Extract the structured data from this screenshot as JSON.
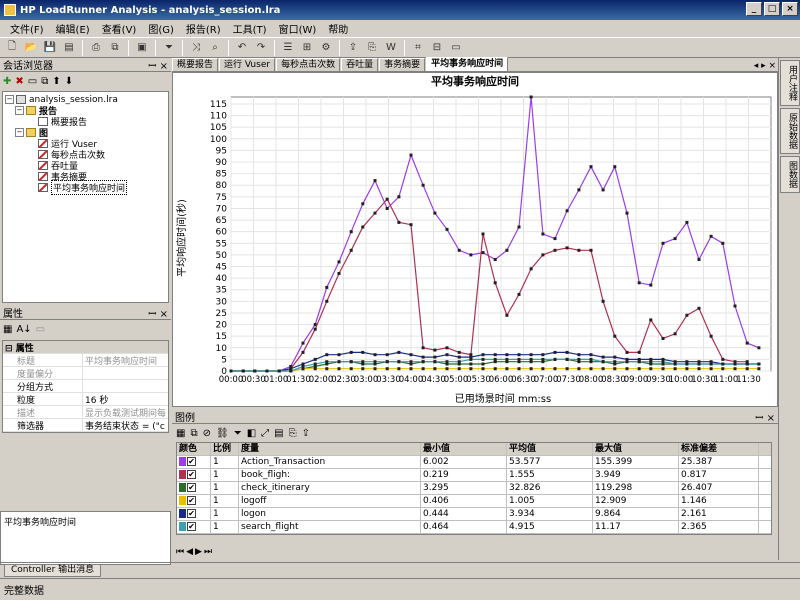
{
  "window": {
    "title": "HP LoadRunner Analysis - analysis_session.lra",
    "buttons": [
      "_",
      "□",
      "×"
    ]
  },
  "menu": [
    "文件(F)",
    "编辑(E)",
    "查看(V)",
    "图(G)",
    "报告(R)",
    "工具(T)",
    "窗口(W)",
    "帮助"
  ],
  "session_browser": {
    "title": "会话浏览器",
    "root": "analysis_session.lra",
    "report_folder": "报告",
    "report_items": [
      "概要报告"
    ],
    "graph_folder": "图",
    "graph_items": [
      "运行 Vuser",
      "每秒点击次数",
      "吞吐量",
      "事务摘要",
      "平均事务响应时间"
    ]
  },
  "properties": {
    "title": "属性",
    "section": "属性",
    "rows": [
      {
        "k": "标题",
        "v": "平均事务响应时间",
        "dim": true
      },
      {
        "k": "度量偏分",
        "v": "",
        "dim": true
      },
      {
        "k": "分组方式",
        "v": "",
        "dim": false
      },
      {
        "k": "粒度",
        "v": "16 秒",
        "dim": false
      },
      {
        "k": "描述",
        "v": "显示负载测试期间每",
        "dim": true
      },
      {
        "k": "筛选器",
        "v": "事务结束状态 = (\"c",
        "dim": false
      }
    ],
    "description": "平均事务响应时间"
  },
  "tabs": [
    "概要报告",
    "运行 Vuser",
    "每秒点击次数",
    "吞吐量",
    "事务摘要",
    "平均事务响应时间"
  ],
  "tab_nav": "◂ ▸ ×",
  "chart_data": {
    "type": "line",
    "title": "平均事务响应时间",
    "xlabel": "已用场景时间 mm:ss",
    "ylabel": "平均响应时间(秒)",
    "ylim": [
      0,
      118
    ],
    "yticks": [
      0,
      5,
      10,
      15,
      20,
      25,
      30,
      35,
      40,
      45,
      50,
      55,
      60,
      65,
      70,
      75,
      80,
      85,
      90,
      95,
      100,
      105,
      110,
      115
    ],
    "x": [
      "00:00",
      "00:30",
      "01:00",
      "01:30",
      "02:00",
      "02:30",
      "03:00",
      "03:30",
      "04:00",
      "04:30",
      "05:00",
      "05:30",
      "06:00",
      "06:30",
      "07:00",
      "07:30",
      "08:00",
      "08:30",
      "09:00",
      "09:30",
      "10:00",
      "10:30",
      "11:00",
      "11:30"
    ],
    "xmax_minutes": 12,
    "x_minutes": [
      0,
      0.27,
      0.53,
      0.8,
      1.07,
      1.33,
      1.6,
      1.87,
      2.13,
      2.4,
      2.67,
      2.93,
      3.2,
      3.47,
      3.73,
      4.0,
      4.27,
      4.53,
      4.8,
      5.07,
      5.33,
      5.6,
      5.87,
      6.13,
      6.4,
      6.67,
      6.93,
      7.2,
      7.47,
      7.73,
      8.0,
      8.27,
      8.53,
      8.8,
      9.07,
      9.33,
      9.6,
      9.87,
      10.13,
      10.4,
      10.67,
      10.93,
      11.2,
      11.47,
      11.73
    ],
    "series": [
      {
        "name": "Action_Transaction",
        "color": "#9b3cf0",
        "values": [
          0,
          0,
          0,
          0,
          0,
          2,
          12,
          20,
          36,
          47,
          60,
          72,
          82,
          70,
          75,
          93,
          80,
          68,
          61,
          52,
          50,
          51,
          48,
          52,
          62,
          118,
          59,
          57,
          69,
          78,
          88,
          78,
          88,
          68,
          38,
          37,
          55,
          57,
          64,
          48,
          58,
          55,
          28,
          12,
          10,
          6
        ]
      },
      {
        "name": "book_flight",
        "color": "#b03050",
        "values": [
          0,
          0,
          0,
          0,
          0,
          1,
          8,
          18,
          30,
          42,
          52,
          62,
          68,
          74,
          64,
          63,
          10,
          9,
          10,
          8,
          7,
          59,
          38,
          24,
          33,
          44,
          50,
          52,
          53,
          52,
          52,
          30,
          15,
          8,
          8,
          22,
          14,
          16,
          24,
          27,
          15,
          5,
          4,
          4
        ]
      },
      {
        "name": "check_itinerary",
        "color": "#2a6e2a",
        "values": [
          0,
          0,
          0,
          0,
          0,
          0,
          1,
          2,
          3,
          4,
          4,
          3,
          3,
          4,
          4,
          3,
          4,
          4,
          3,
          3,
          3,
          3,
          4,
          4,
          4,
          4,
          4,
          5,
          5,
          4,
          4,
          4,
          3,
          4,
          4,
          3,
          3,
          3,
          3,
          3,
          3,
          3,
          3,
          3,
          3
        ]
      },
      {
        "name": "logoff",
        "color": "#e8c000",
        "values": [
          0,
          0,
          0,
          0,
          0,
          0,
          1,
          1,
          1,
          1,
          1,
          1,
          1,
          1,
          1,
          1,
          1,
          1,
          1,
          1,
          1,
          1,
          1,
          1,
          1,
          1,
          1,
          1,
          1,
          1,
          1,
          1,
          1,
          1,
          1,
          1,
          1,
          1,
          1,
          1,
          1,
          1,
          1,
          1,
          1
        ]
      },
      {
        "name": "logon",
        "color": "#1a2a8a",
        "values": [
          0,
          0,
          0,
          0,
          0,
          1,
          3,
          5,
          7,
          7,
          8,
          8,
          7,
          7,
          8,
          7,
          6,
          6,
          7,
          6,
          6,
          7,
          7,
          7,
          7,
          7,
          7,
          8,
          8,
          7,
          7,
          6,
          6,
          5,
          5,
          5,
          5,
          4,
          4,
          4,
          4,
          3,
          3,
          3,
          3
        ]
      },
      {
        "name": "search_flight",
        "color": "#3aa0b0",
        "values": [
          0,
          0,
          0,
          0,
          0,
          0,
          2,
          3,
          4,
          4,
          4,
          4,
          4,
          4,
          4,
          4,
          4,
          4,
          4,
          4,
          5,
          5,
          5,
          5,
          5,
          5,
          5,
          5,
          5,
          5,
          5,
          4,
          4,
          4,
          4,
          4,
          4,
          3,
          3,
          3,
          3,
          3,
          3,
          3,
          3
        ]
      }
    ]
  },
  "legend": {
    "title": "图例",
    "headers": [
      "颜色",
      "比例",
      "度量",
      "最小值",
      "平均值",
      "最大值",
      "标准偏差"
    ],
    "rows": [
      {
        "color": "#9b3cf0",
        "scale": "1",
        "measure": "Action_Transaction",
        "min": "6.002",
        "avg": "53.577",
        "max": "155.399",
        "std": "25.387"
      },
      {
        "color": "#b03050",
        "scale": "1",
        "measure": "book_fligh:",
        "min": "0.219",
        "avg": "1.555",
        "max": "3.949",
        "std": "0.817"
      },
      {
        "color": "#2a6e2a",
        "scale": "1",
        "measure": "check_itinerary",
        "min": "3.295",
        "avg": "32.826",
        "max": "119.298",
        "std": "26.407"
      },
      {
        "color": "#e8c000",
        "scale": "1",
        "measure": "logoff",
        "min": "0.406",
        "avg": "1.005",
        "max": "12.909",
        "std": "1.146"
      },
      {
        "color": "#1a2a8a",
        "scale": "1",
        "measure": "logon",
        "min": "0.444",
        "avg": "3.934",
        "max": "9.864",
        "std": "2.161"
      },
      {
        "color": "#3aa0b0",
        "scale": "1",
        "measure": "search_flight",
        "min": "0.464",
        "avg": "4.915",
        "max": "11.17",
        "std": "2.365"
      }
    ]
  },
  "right_tabs": [
    "用户注释",
    "原始数据",
    "图数据"
  ],
  "bottom_tab": "Controller 输出消息",
  "status": "完整数据"
}
